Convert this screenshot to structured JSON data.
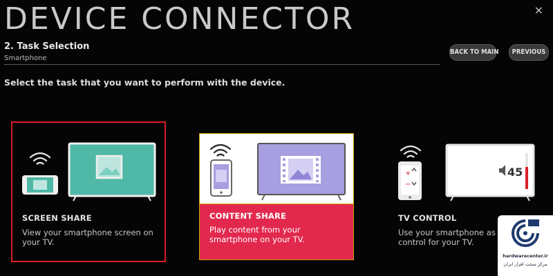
{
  "header": {
    "title": "DEVICE CONNECTOR",
    "close_symbol": "×",
    "step_title": "2. Task Selection",
    "step_subtitle": "Smartphone"
  },
  "buttons": {
    "back_to_main": "BACK TO MAIN",
    "previous": "PREVIOUS"
  },
  "instruction": "Select the task that you want to perform with the device.",
  "cards": [
    {
      "name": "SCREEN SHARE",
      "description": "View your smartphone screen on your TV.",
      "selected": true,
      "icon": "screen-share-icon"
    },
    {
      "name": "CONTENT SHARE",
      "description": "Play content from your smartphone on your TV.",
      "highlighted": true,
      "icon": "content-share-icon"
    },
    {
      "name": "TV CONTROL",
      "description": "Use your smartphone as a remote control for your TV.",
      "icon": "tv-control-icon"
    }
  ],
  "tv_control_volume": "45",
  "watermark": {
    "site": "hardwarecenter.ir",
    "persian": "مرکز سخت افزار ایران"
  },
  "colors": {
    "selection_outline": "#d81f2a",
    "content_share_bg": "#e2284d",
    "screen_tv": "#4fb8a6",
    "content_tv": "#a79fe0"
  }
}
